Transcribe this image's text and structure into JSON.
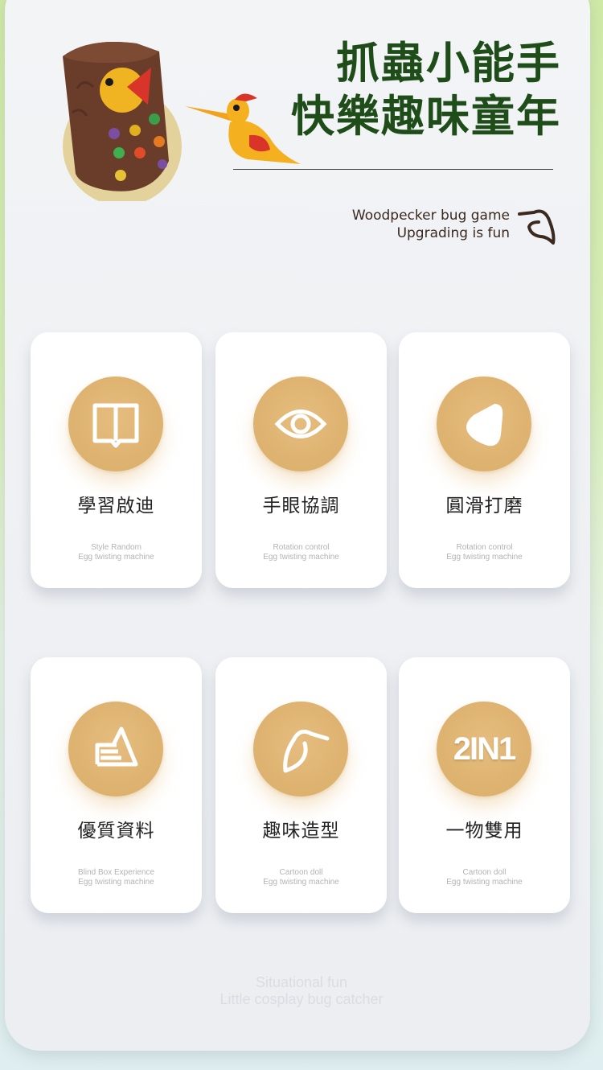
{
  "hero": {
    "title_line1": "抓蟲小能手",
    "title_line2": "快樂趣味童年",
    "subtitle_line1": "Woodpecker bug game",
    "subtitle_line2": "Upgrading is fun"
  },
  "features": [
    {
      "icon": "book-icon",
      "title": "學習啟迪",
      "caption1": "Style Random",
      "caption2": "Egg twisting machine"
    },
    {
      "icon": "eye-icon",
      "title": "手眼協調",
      "caption1": "Rotation control",
      "caption2": "Egg twisting machine"
    },
    {
      "icon": "rounded-triangle-icon",
      "title": "圓滑打磨",
      "caption1": "Rotation control",
      "caption2": "Egg twisting machine"
    },
    {
      "icon": "document-triangle-icon",
      "title": "優質資料",
      "caption1": "Blind Box Experience",
      "caption2": "Egg twisting machine"
    },
    {
      "icon": "bird-icon",
      "title": "趣味造型",
      "caption1": "Cartoon doll",
      "caption2": "Egg twisting machine"
    },
    {
      "icon": "2in1-badge",
      "badge_text": "2IN1",
      "title": "一物雙用",
      "caption1": "Cartoon doll",
      "caption2": "Egg twisting machine"
    }
  ],
  "footer": {
    "line1": "Situational fun",
    "line2": "Little cosplay bug catcher"
  },
  "colors": {
    "title_green": "#1f4d1a",
    "medal_gold": "#dfb472",
    "background_green": "#cfeaa6"
  }
}
